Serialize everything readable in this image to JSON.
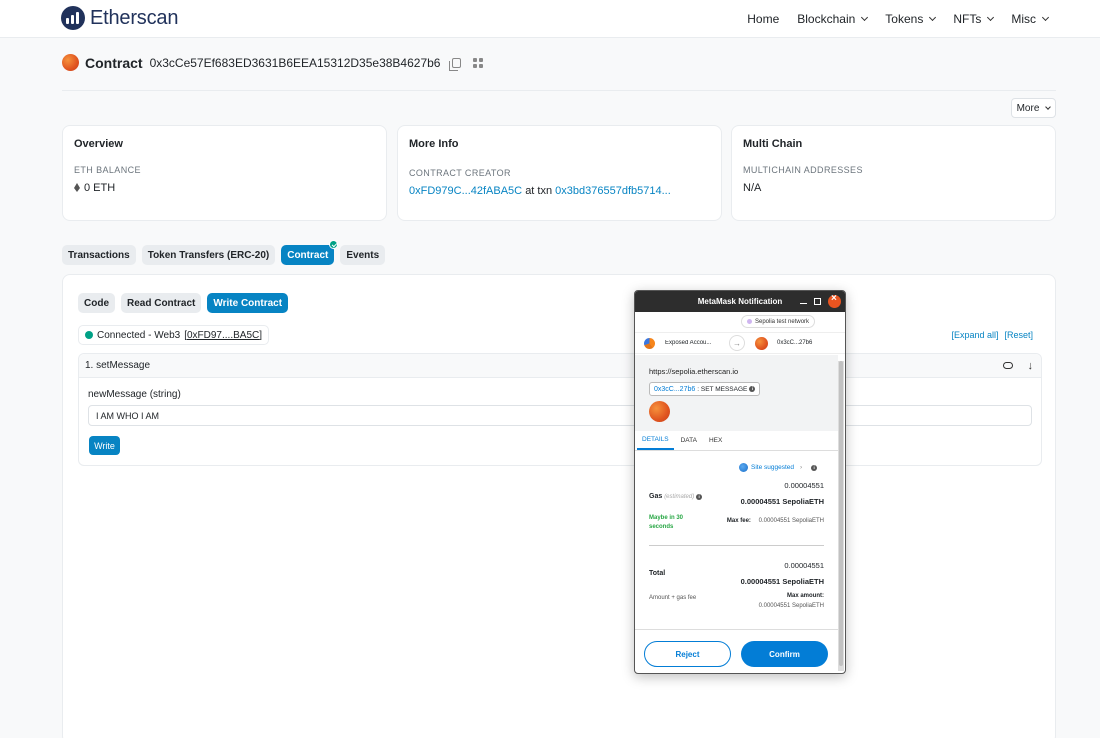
{
  "brand": {
    "name": "Etherscan"
  },
  "nav": {
    "items": [
      "Home",
      "Blockchain",
      "Tokens",
      "NFTs",
      "Misc"
    ]
  },
  "contract": {
    "label": "Contract",
    "address": "0x3cCe57Ef683ED3631B6EEA15312D35e38B4627b6"
  },
  "more_button": "More",
  "cards": {
    "overview": {
      "title": "Overview",
      "caption": "ETH BALANCE",
      "value": "0 ETH"
    },
    "more_info": {
      "title": "More Info",
      "caption": "CONTRACT CREATOR",
      "creator": "0xFD979C...42fABA5C",
      "at_txn": "at txn",
      "txn": "0x3bd376557dfb5714..."
    },
    "multi_chain": {
      "title": "Multi Chain",
      "caption": "MULTICHAIN ADDRESSES",
      "value": "N/A"
    }
  },
  "tabs": [
    "Transactions",
    "Token Transfers (ERC-20)",
    "Contract",
    "Events"
  ],
  "subtabs": [
    "Code",
    "Read Contract",
    "Write Contract"
  ],
  "connection": {
    "text": "Connected - Web3",
    "account": "[0xFD97....BA5C]"
  },
  "expand": {
    "expand_all": "[Expand all]",
    "reset": "[Reset]"
  },
  "method": {
    "title": "1. setMessage",
    "param_label": "newMessage (string)",
    "param_value": "I AM WHO I AM",
    "write_label": "Write"
  },
  "metamask": {
    "title": "MetaMask Notification",
    "network": "Sepolia test network",
    "from_account": "Exposed Accou...",
    "to_account": "0x3cC...27b6",
    "origin_url": "https://sepolia.etherscan.io",
    "method_addr": "0x3cC...27b6",
    "method_name": ": SET MESSAGE",
    "tabs": [
      "DETAILS",
      "DATA",
      "HEX"
    ],
    "site_suggested": "Site suggested",
    "gas": {
      "label": "Gas",
      "estimated": "(estimated)",
      "small_value": "0.00004551",
      "bold_value": "0.00004551 SepoliaETH",
      "timing": "Maybe in 30 seconds",
      "max_fee_label": "Max fee:",
      "max_fee_value": "0.00004551 SepoliaETH"
    },
    "total": {
      "label": "Total",
      "small_value": "0.00004551",
      "bold_value": "0.00004551 SepoliaETH",
      "sub_label": "Amount + gas fee",
      "max_amount_label": "Max amount:",
      "max_amount_value": "0.00004551 SepoliaETH"
    },
    "reject_label": "Reject",
    "confirm_label": "Confirm"
  }
}
